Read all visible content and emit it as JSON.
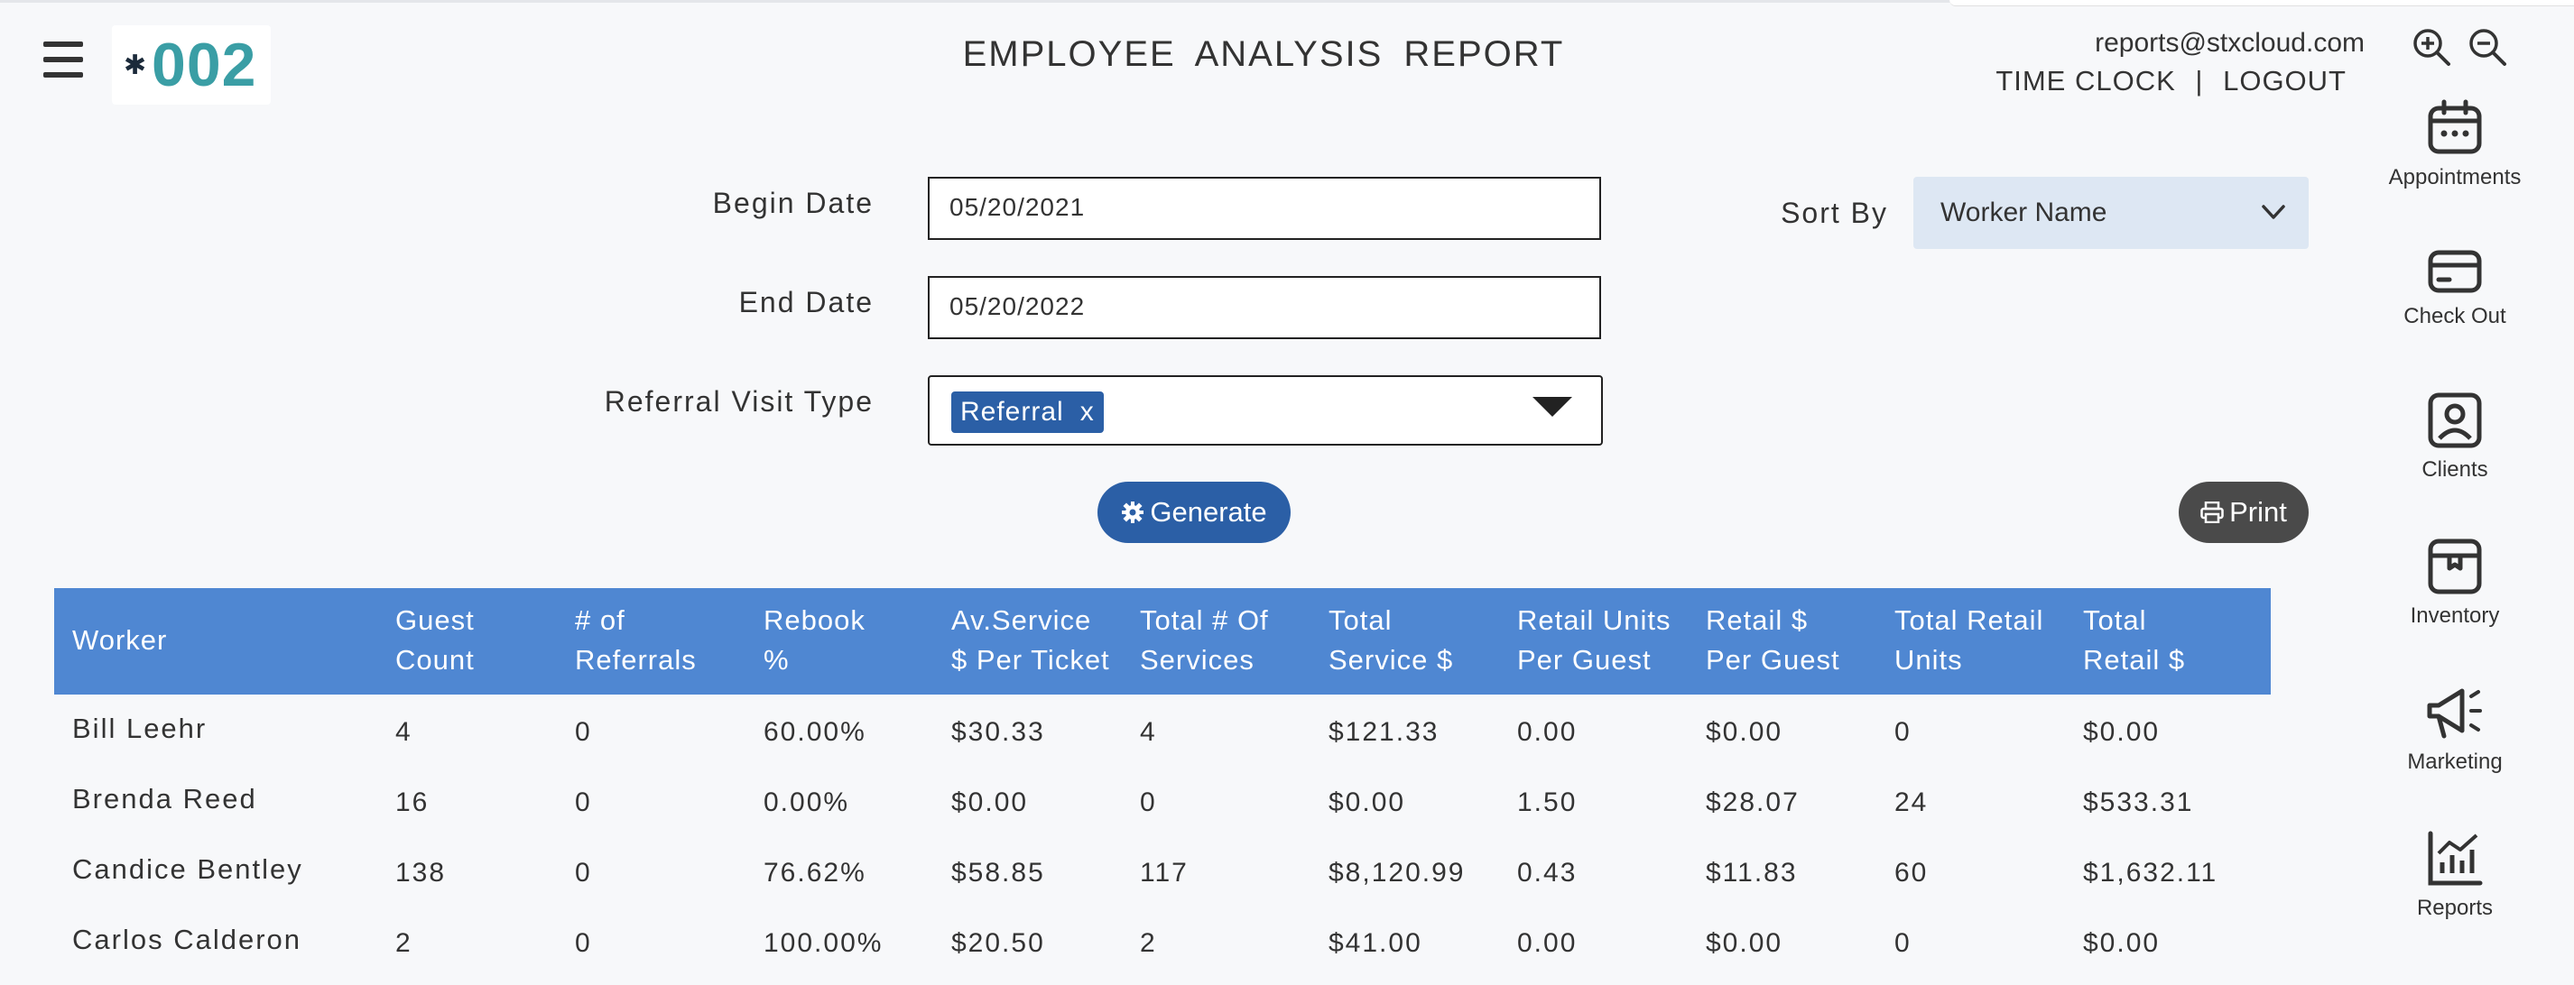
{
  "header": {
    "title": "EMPLOYEE  ANALYSIS  REPORT",
    "logo_text": "002",
    "logo_star": "✱",
    "email": "reports@stxcloud.com",
    "time_clock": "TIME CLOCK",
    "separator": "|",
    "logout": "LOGOUT"
  },
  "form": {
    "begin_date_label": "Begin Date",
    "begin_date_value": "05/20/2021",
    "end_date_label": "End Date",
    "end_date_value": "05/20/2022",
    "referral_label": "Referral Visit Type",
    "referral_tag": "Referral",
    "referral_tag_remove": "x",
    "sort_by_label": "Sort By",
    "sort_by_value": "Worker Name",
    "generate_label": "Generate",
    "print_label": "Print"
  },
  "table": {
    "headers": [
      "Worker",
      "Guest\nCount",
      "# of\nReferrals",
      "Rebook\n%",
      "Av.Service\n$ Per Ticket",
      "Total # Of\nServices",
      "Total\nService $",
      "Retail Units\nPer Guest",
      "Retail $\nPer Guest",
      "Total Retail\nUnits",
      "Total\nRetail $"
    ],
    "rows": [
      [
        "Bill Leehr",
        "4",
        "0",
        "60.00%",
        "$30.33",
        "4",
        "$121.33",
        "0.00",
        "$0.00",
        "0",
        "$0.00"
      ],
      [
        "Brenda Reed",
        "16",
        "0",
        "0.00%",
        "$0.00",
        "0",
        "$0.00",
        "1.50",
        "$28.07",
        "24",
        "$533.31"
      ],
      [
        "Candice Bentley",
        "138",
        "0",
        "76.62%",
        "$58.85",
        "117",
        "$8,120.99",
        "0.43",
        "$11.83",
        "60",
        "$1,632.11"
      ],
      [
        "Carlos Calderon",
        "2",
        "0",
        "100.00%",
        "$20.50",
        "2",
        "$41.00",
        "0.00",
        "$0.00",
        "0",
        "$0.00"
      ]
    ]
  },
  "sidebar": {
    "items": [
      {
        "label": "Appointments",
        "icon": "calendar-icon"
      },
      {
        "label": "Check Out",
        "icon": "credit-card-icon"
      },
      {
        "label": "Clients",
        "icon": "user-icon"
      },
      {
        "label": "Inventory",
        "icon": "box-icon"
      },
      {
        "label": "Marketing",
        "icon": "megaphone-icon"
      },
      {
        "label": "Reports",
        "icon": "chart-icon"
      }
    ]
  },
  "colors": {
    "accent": "#2b5fa6",
    "table_header": "#4f87d2",
    "print_button": "#4a4a4a",
    "logo_teal": "#3a9ea5",
    "select_bg": "#dde7f3"
  }
}
